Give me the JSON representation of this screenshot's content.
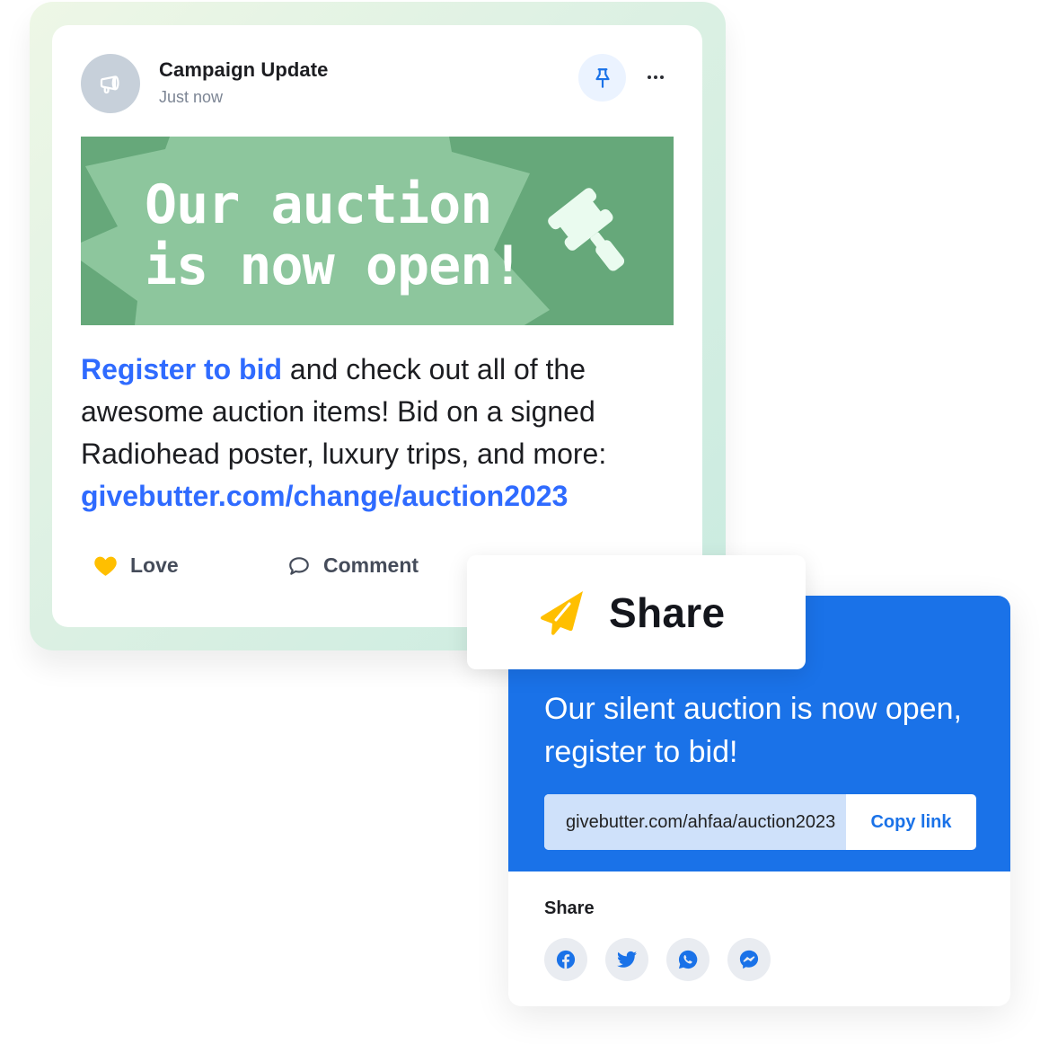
{
  "post": {
    "title": "Campaign Update",
    "timestamp": "Just now",
    "avatar_icon": "megaphone-icon",
    "pin_icon": "pin-icon",
    "more_icon": "more-horizontal-icon",
    "banner": {
      "line1": "Our auction",
      "line2": "is now open!",
      "icon": "gavel-icon",
      "colors": {
        "dark": "#66a87a",
        "light": "#8dc69d",
        "icon": "#eafbef"
      }
    },
    "body": {
      "link_text": "Register to bid",
      "text": " and check out all of the awesome auction items! Bid on a signed Radiohead poster, luxury trips, and more: ",
      "url": "givebutter.com/change/auction2023"
    },
    "actions": [
      {
        "label": "Love",
        "icon": "heart-icon"
      },
      {
        "label": "Comment",
        "icon": "comment-icon"
      }
    ]
  },
  "share": {
    "tab_label": "Share",
    "tab_icon": "paper-plane-icon",
    "heading": "Our silent auction is now open, register to bid!",
    "link_value": "givebutter.com/ahfaa/auction2023",
    "copy_label": "Copy link",
    "section_label": "Share",
    "socials": [
      {
        "name": "Facebook",
        "icon": "facebook-icon"
      },
      {
        "name": "Twitter",
        "icon": "twitter-icon"
      },
      {
        "name": "WhatsApp",
        "icon": "whatsapp-icon"
      },
      {
        "name": "Messenger",
        "icon": "messenger-icon"
      }
    ]
  },
  "colors": {
    "link_blue": "#2f6bff",
    "share_blue": "#1a72e8",
    "accent_yellow": "#ffbf00"
  }
}
